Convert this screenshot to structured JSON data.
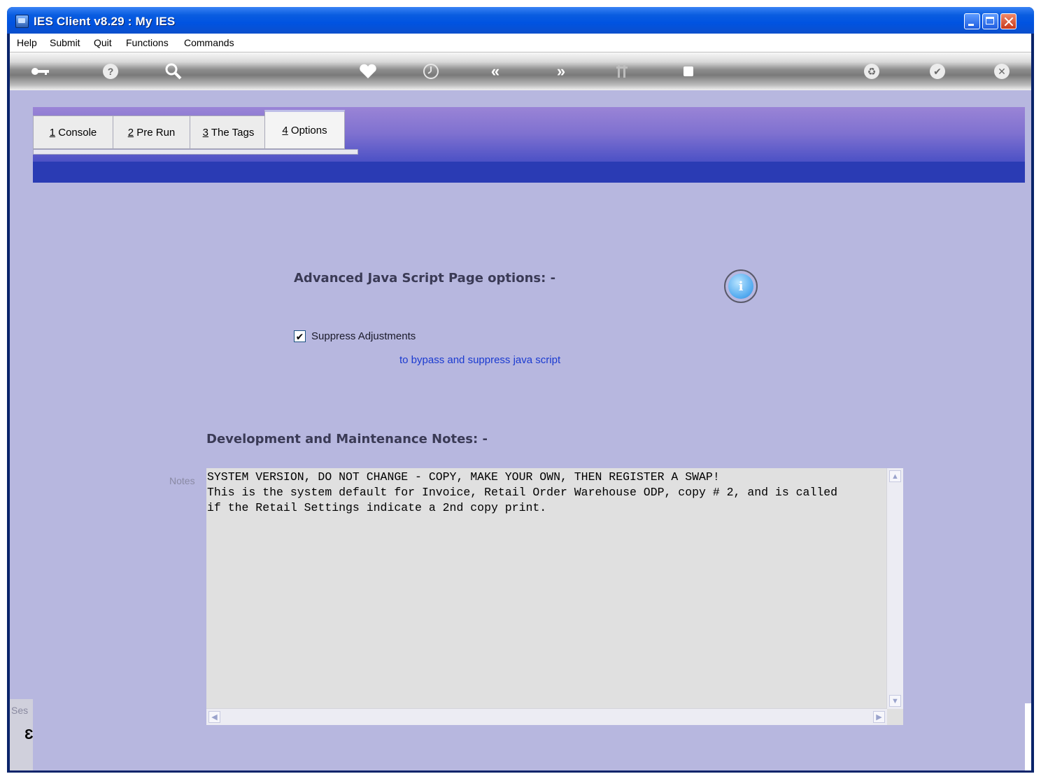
{
  "window": {
    "title": "IES Client v8.29 : My IES"
  },
  "menu": [
    "Help",
    "Submit",
    "Quit",
    "Functions",
    "Commands"
  ],
  "toolbar": {
    "icons": [
      "key-icon",
      "help-icon",
      "search-icon",
      "heart-icon",
      "clock-icon",
      "back-icon",
      "forward-icon",
      "tools-icon",
      "stop-icon",
      "recycle-icon",
      "check-icon",
      "cancel-icon"
    ]
  },
  "tabs": [
    {
      "num": "1",
      "label": " Console"
    },
    {
      "num": "2",
      "label": " Pre Run"
    },
    {
      "num": "3",
      "label": " The Tags"
    },
    {
      "num": "4",
      "label": " Options"
    }
  ],
  "options": {
    "heading": "Advanced Java Script Page options: -",
    "checkbox_label": "Suppress Adjustments",
    "checkbox_checked": true,
    "hint": "to bypass and suppress java script"
  },
  "notes": {
    "heading": "Development and Maintenance Notes: -",
    "label": "Notes",
    "text": "SYSTEM VERSION, DO NOT CHANGE - COPY, MAKE YOUR OWN, THEN REGISTER A SWAP!\nThis is the system default for Invoice, Retail Order Warehouse ODP, copy # 2, and is called\nif the Retail Settings indicate a 2nd copy print."
  },
  "side": {
    "text": "Ses",
    "glyph": "Ɛ"
  }
}
